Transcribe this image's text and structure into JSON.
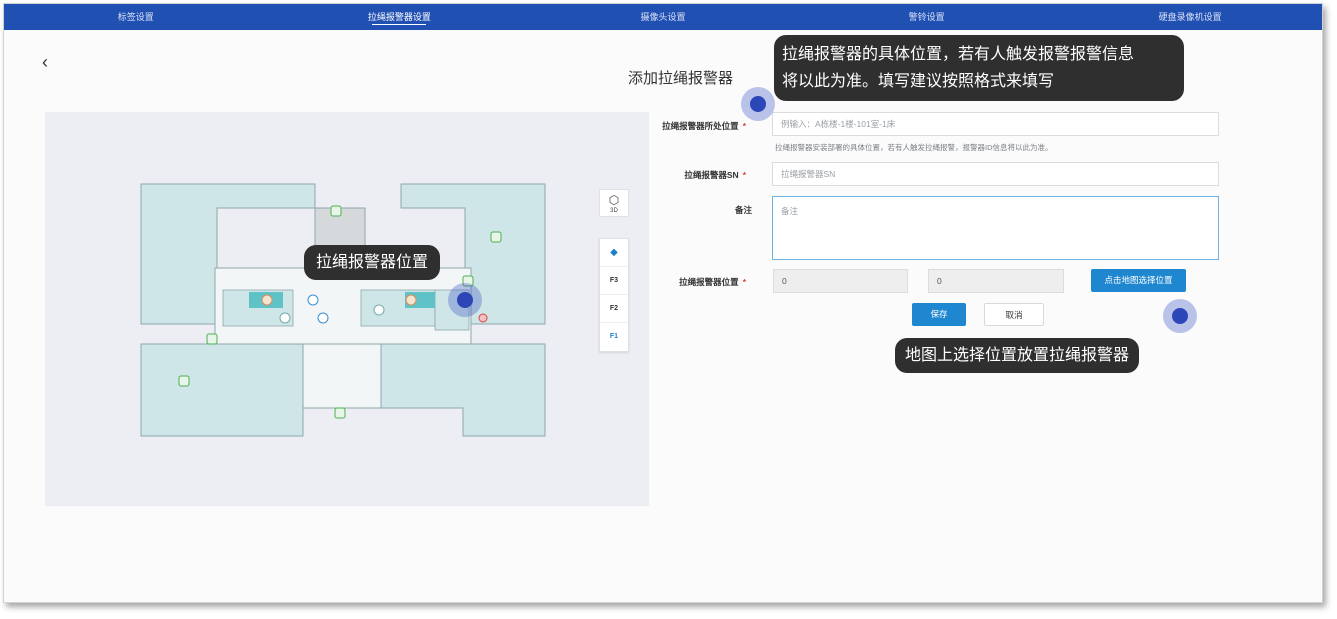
{
  "nav": {
    "tabs": [
      {
        "label": "标签设置",
        "active": false
      },
      {
        "label": "拉绳报警器设置",
        "active": true
      },
      {
        "label": "摄像头设置",
        "active": false
      },
      {
        "label": "警铃设置",
        "active": false
      },
      {
        "label": "硬盘录像机设置",
        "active": false
      }
    ]
  },
  "page": {
    "back_icon": "chevron-left-icon",
    "title": "添加拉绳报警器"
  },
  "map": {
    "mode_3d_label": "3D",
    "floors": [
      "F3",
      "F2",
      "F1"
    ],
    "active_floor": "F1",
    "tooltip": "拉绳报警器位置"
  },
  "form": {
    "location_label": "拉绳报警器所处位置",
    "location_placeholder": "例输入：A栋楼-1楼-101室-1床",
    "location_hint": "拉绳报警器安装部署的具体位置，若有人触发拉绳报警，报警器ID信息将以此为准。",
    "sn_label": "拉绳报警器SN",
    "sn_placeholder": "拉绳报警器SN",
    "remark_label": "备注",
    "remark_placeholder": "备注",
    "position_label": "拉绳报警器位置",
    "pos_x": "0",
    "pos_y": "0",
    "pick_button": "点击地图选择位置",
    "save_button": "保存",
    "cancel_button": "取消"
  },
  "annotations": {
    "location_tip_line1": "拉绳报警器的具体位置，若有人触发报警报警信息",
    "location_tip_line2": "将以此为准。填写建议按照格式来填写",
    "pick_tip": "地图上选择位置放置拉绳报警器"
  },
  "colors": {
    "nav_bg": "#2150b3",
    "primary": "#1f87cf",
    "room_fill": "#cfe6e8",
    "tooltip_bg": "#2f2f2f"
  }
}
